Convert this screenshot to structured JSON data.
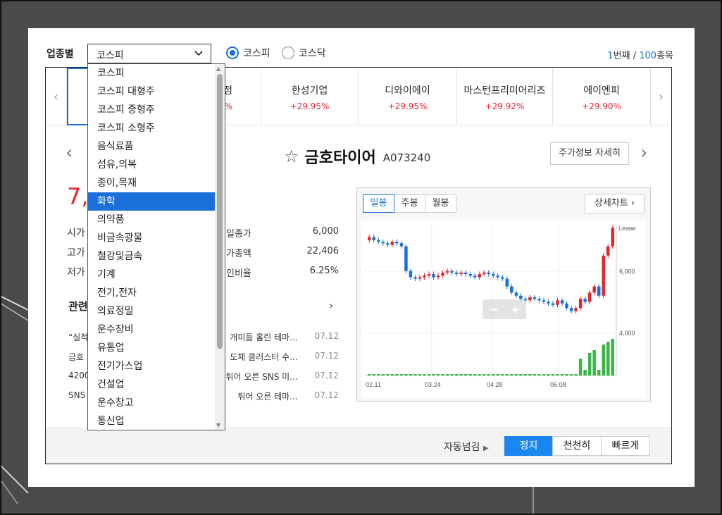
{
  "filter": {
    "label": "업종별",
    "selected": "코스피",
    "radios": [
      {
        "label": "코스피",
        "checked": true
      },
      {
        "label": "코스닥",
        "checked": false
      }
    ],
    "counter": {
      "current": "1",
      "current_suffix": "번째 / ",
      "total": "100",
      "total_suffix": "종목"
    }
  },
  "tickers": [
    {
      "name": "",
      "change": ""
    },
    {
      "name": "점",
      "change": "%"
    },
    {
      "name": "한성기업",
      "change": "+29.95%"
    },
    {
      "name": "디와이에이",
      "change": "+29.95%"
    },
    {
      "name": "마스턴프리미어리즈",
      "change": "+29.92%"
    },
    {
      "name": "에이엔피",
      "change": "+29.90%"
    }
  ],
  "stock": {
    "name": "금호타이어",
    "code": "A073240",
    "detail_button": "주가정보 자세히",
    "price_partial": "7,8",
    "left_labels": [
      "시가",
      "고가",
      "저가"
    ],
    "stats": [
      {
        "label": "일종가",
        "value": "6,000"
      },
      {
        "label": "가총액",
        "value": "22,406"
      },
      {
        "label": "인비율",
        "value": "6.25%"
      }
    ],
    "related_title": "관련",
    "related": [
      {
        "left": "“실적",
        "right": "개미들 홀린 테마...",
        "date": "07.12"
      },
      {
        "left": "금호",
        "right": "도체 클러스터 수...",
        "date": "07.12"
      },
      {
        "left": "4200",
        "right": "튀어 오른 SNS 미...",
        "date": "07.12"
      },
      {
        "left": "SNS",
        "right": "튀어 오른 테마...",
        "date": "07.12"
      }
    ]
  },
  "chart": {
    "tabs": [
      "일봉",
      "주봉",
      "월봉"
    ],
    "active_tab": "일봉",
    "detail_button": "상세차트",
    "scale_label": "Linear",
    "y_ticks": [
      "6,000",
      "4,000"
    ],
    "x_ticks": [
      "02.11",
      "03.24",
      "04.28",
      "06.08"
    ],
    "up_color": "#e0262f",
    "down_color": "#1a6fd8",
    "volume_color": "#3bb54a"
  },
  "chart_data": {
    "type": "candlestick",
    "xlabel": "",
    "ylabel": "",
    "x_ticks": [
      "02.11",
      "03.24",
      "04.28",
      "06.08"
    ],
    "ylim": [
      3800,
      7500
    ],
    "series": [
      {
        "values": [
          7100,
          7000,
          6950,
          6900,
          6850,
          6950,
          6900,
          6800,
          6000,
          5800,
          5750,
          5800,
          5850,
          5900,
          5800,
          5850,
          5950,
          6000,
          5950,
          5900,
          5950,
          5900,
          5850,
          5800,
          5900,
          5950,
          5900,
          5850,
          5800,
          5750,
          5500,
          5300,
          5200,
          5100,
          5050,
          5150,
          5100,
          5050,
          5000,
          4950,
          4900,
          5050,
          4950,
          4800,
          4700,
          4800,
          5100,
          5000,
          5300,
          5500,
          5200,
          6500,
          6800,
          7400
        ]
      }
    ]
  },
  "footer": {
    "auto_label": "자동넘김",
    "buttons": [
      "정지",
      "천천히",
      "빠르게"
    ],
    "active": "정지"
  },
  "dropdown": {
    "items": [
      "코스피",
      "코스피 대형주",
      "코스피 중형주",
      "코스피 소형주",
      "음식료품",
      "섬유,의복",
      "종이,목재",
      "화학",
      "의약품",
      "비금속광물",
      "철강및금속",
      "기계",
      "전기,전자",
      "의료정밀",
      "운수장비",
      "유통업",
      "전기가스업",
      "건설업",
      "운수창고",
      "통신업"
    ],
    "highlighted": "화학"
  }
}
